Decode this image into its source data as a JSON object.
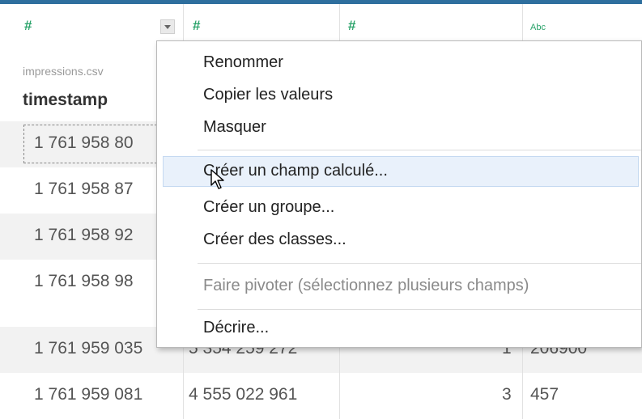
{
  "columns": [
    {
      "type_icon": "#",
      "source": "impressions.csv",
      "name": "timestamp"
    },
    {
      "type_icon": "#"
    },
    {
      "type_icon": "#"
    },
    {
      "type_icon": "Abc"
    }
  ],
  "rows": [
    {
      "c1": "1 761 958 80",
      "c2": "",
      "c3": "",
      "c4": ""
    },
    {
      "c1": "1 761 958 87",
      "c2": "",
      "c3": "",
      "c4": ""
    },
    {
      "c1": "1 761 958 92",
      "c2": "",
      "c3": "",
      "c4": ""
    },
    {
      "c1": "1 761 958 98",
      "c2": "",
      "c3": "",
      "c4": ""
    },
    {
      "c1": "1 761 959 035",
      "c2": "5 354 259 272",
      "c3": "1",
      "c4": "206900"
    },
    {
      "c1": "1 761 959 081",
      "c2": "4 555 022 961",
      "c3": "3",
      "c4": "457"
    }
  ],
  "menu": {
    "items": [
      "Renommer",
      "Copier les valeurs",
      "Masquer",
      "Créer un champ calculé...",
      "Créer un groupe...",
      "Créer des classes...",
      "Faire pivoter (sélectionnez plusieurs champs)",
      "Décrire..."
    ],
    "highlighted_index": 3,
    "disabled_index": 6
  },
  "colors": {
    "accent": "#2e6f9e",
    "type_icon": "#2aa36a",
    "highlight": "#e9f1fb"
  }
}
